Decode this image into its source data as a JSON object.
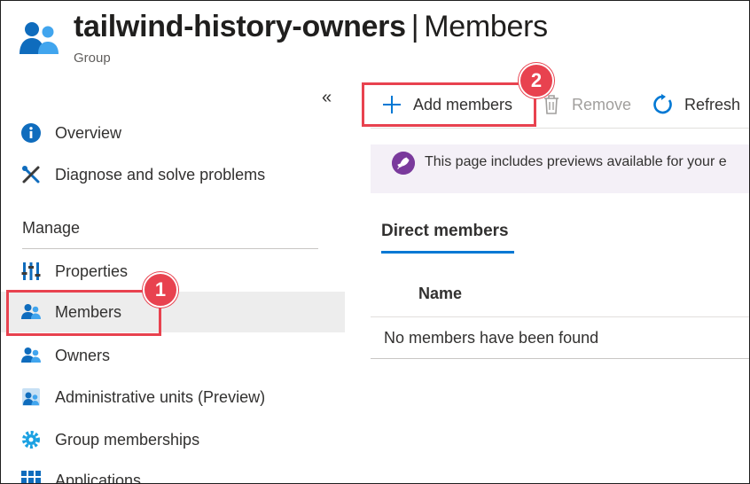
{
  "header": {
    "title_name": "tailwind-history-owners",
    "title_separator": "|",
    "title_page": "Members",
    "subtitle": "Group",
    "icon": "group-people-icon"
  },
  "sidebar": {
    "collapse_glyph": "«",
    "items_top": [
      {
        "label": "Overview",
        "icon": "info-icon"
      },
      {
        "label": "Diagnose and solve problems",
        "icon": "wrench-screwdriver-icon"
      }
    ],
    "section_label": "Manage",
    "items_manage": [
      {
        "label": "Properties",
        "icon": "properties-icon"
      },
      {
        "label": "Members",
        "icon": "members-icon",
        "selected": true
      },
      {
        "label": "Owners",
        "icon": "owners-icon"
      },
      {
        "label": "Administrative units (Preview)",
        "icon": "admin-units-icon"
      },
      {
        "label": "Group memberships",
        "icon": "gear-icon"
      },
      {
        "label": "Applications",
        "icon": "apps-grid-icon"
      }
    ]
  },
  "toolbar": {
    "add_members_label": "Add members",
    "remove_label": "Remove",
    "refresh_label": "Refresh"
  },
  "banner": {
    "text": "This page includes previews available for your e",
    "icon": "rocket-icon"
  },
  "tabs": {
    "direct_members": "Direct members"
  },
  "table": {
    "columns": [
      "Name"
    ],
    "empty_message": "No members have been found"
  },
  "callouts": [
    "1",
    "2"
  ],
  "colors": {
    "accent": "#0078d4",
    "callout": "#e8424f",
    "selected_bg": "#ededed",
    "banner_bg": "#f4f0f7"
  }
}
